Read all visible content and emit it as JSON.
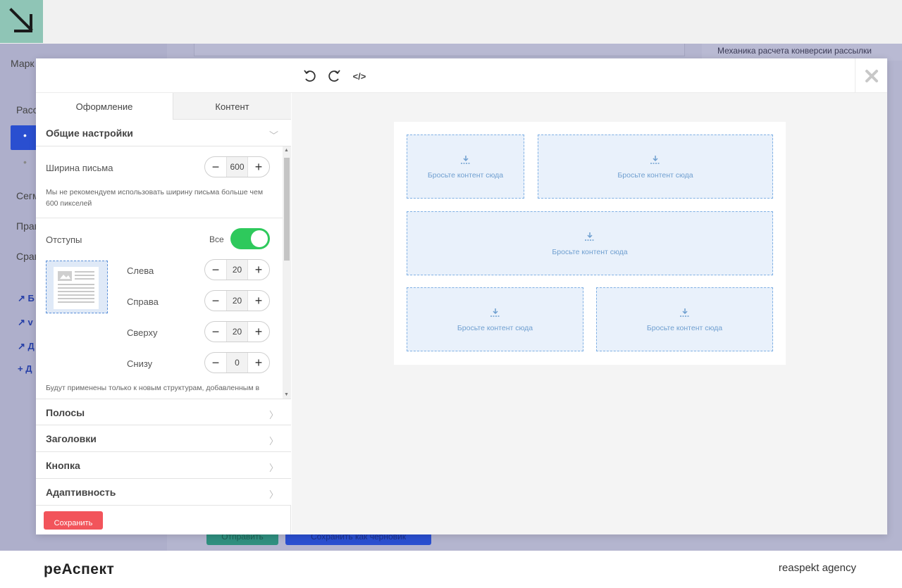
{
  "background_app": {
    "sidebar_items": [
      "Марк",
      "Расс",
      "Сегм",
      "Прав",
      "Срав"
    ],
    "sidebar_links": [
      "Б",
      "v",
      "Д",
      "Д"
    ],
    "right_note": "Механика расчета конверсии рассылки",
    "send_button": "Отправить",
    "draft_button": "Сохранить как черновик"
  },
  "editor": {
    "toolbar": {
      "undo_icon": "undo-icon",
      "redo_icon": "redo-icon",
      "code_label": "</>",
      "close_icon": "close-icon"
    },
    "tabs": [
      {
        "label": "Оформление",
        "active": true
      },
      {
        "label": "Контент",
        "active": false
      }
    ],
    "general_settings": {
      "title": "Общие настройки",
      "width_label": "Ширина письма",
      "width_value": "600",
      "width_note": "Мы не рекомендуем использовать ширину письма больше чем 600 пикселей",
      "paddings_label": "Отступы",
      "all_label": "Все",
      "all_toggle_on": true,
      "paddings": [
        {
          "label": "Слева",
          "value": "20"
        },
        {
          "label": "Справа",
          "value": "20"
        },
        {
          "label": "Сверху",
          "value": "20"
        },
        {
          "label": "Снизу",
          "value": "0"
        }
      ],
      "paddings_note": "Будут применены только к новым структурам, добавленным в"
    },
    "sections": [
      "Полосы",
      "Заголовки",
      "Кнопка",
      "Адаптивность"
    ],
    "save_button": "Сохранить",
    "drop_zone_text": "Бросьте контент сюда"
  },
  "footer": {
    "brand_left": "реАспект",
    "brand_right": "reaspekt agency"
  },
  "colors": {
    "accent_green": "#2ec95c",
    "save_red": "#f2545b",
    "drop_blue": "#7fb0e4",
    "logo_teal": "#8fc5b6"
  }
}
